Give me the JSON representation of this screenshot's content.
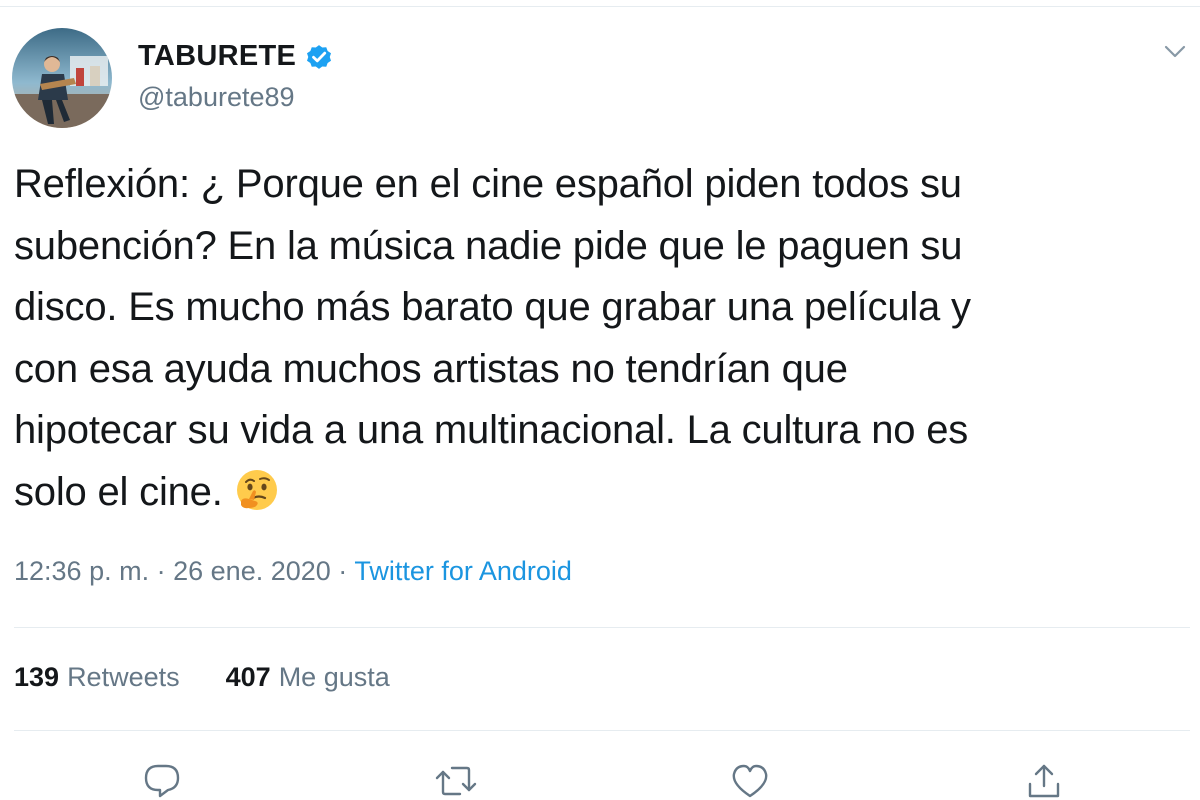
{
  "user": {
    "display_name": "TABURETE",
    "handle": "@taburete89",
    "verified": true,
    "avatar_icon": "concert-photo-avatar"
  },
  "tweet": {
    "lines": [
      "Reflexión: ¿ Porque en el cine español piden todos su",
      "subención? En la música nadie pide que le paguen su",
      "disco. Es mucho más barato que grabar una película y",
      "con esa ayuda muchos artistas no tendrían que",
      "hipotecar su vida a una multinacional. La cultura no es",
      "solo el cine."
    ],
    "emoji": "thinking-face"
  },
  "meta": {
    "time": "12:36 p. m.",
    "separator": "·",
    "date": "26 ene. 2020",
    "source": "Twitter for Android"
  },
  "stats": {
    "retweets_count": "139",
    "retweets_label": "Retweets",
    "likes_count": "407",
    "likes_label": "Me gusta"
  },
  "colors": {
    "text": "#14171a",
    "secondary": "#657786",
    "link": "#1b95e0",
    "verified": "#1da1f2",
    "divider": "#e6ecf0"
  }
}
